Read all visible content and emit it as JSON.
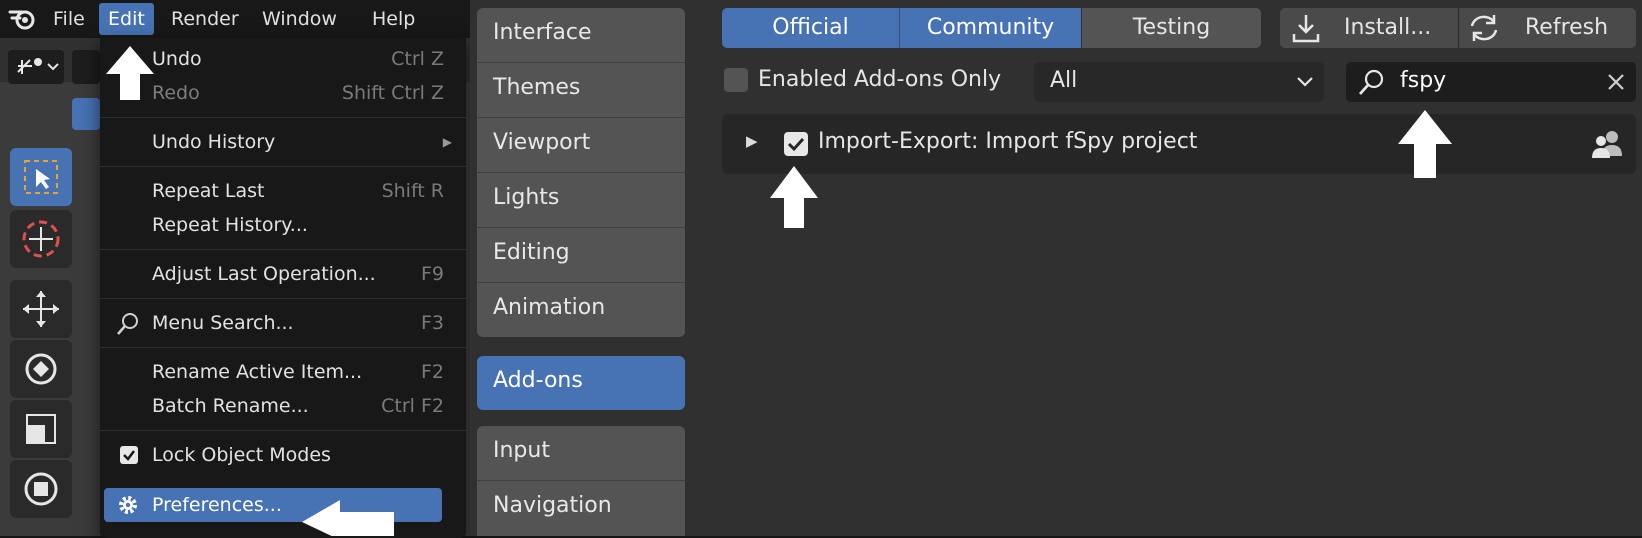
{
  "menubar": {
    "items": [
      "File",
      "Edit",
      "Render",
      "Window",
      "Help"
    ],
    "active": "Edit"
  },
  "edit_menu": {
    "items": [
      {
        "label": "Undo",
        "shortcut": "Ctrl Z"
      },
      {
        "label": "Redo",
        "shortcut": "Shift Ctrl Z",
        "disabled": true
      },
      {
        "label": "Undo History",
        "submenu": true
      },
      {
        "label": "Repeat Last",
        "shortcut": "Shift R"
      },
      {
        "label": "Repeat History..."
      },
      {
        "label": "Adjust Last Operation...",
        "shortcut": "F9"
      },
      {
        "label": "Menu Search...",
        "shortcut": "F3"
      },
      {
        "label": "Rename Active Item...",
        "shortcut": "F2"
      },
      {
        "label": "Batch Rename...",
        "shortcut": "Ctrl F2"
      },
      {
        "label": "Lock Object Modes",
        "checked": true
      },
      {
        "label": "Preferences...",
        "highlighted": true
      }
    ]
  },
  "prefs_nav": {
    "group1": [
      "Interface",
      "Themes",
      "Viewport",
      "Lights",
      "Editing",
      "Animation"
    ],
    "group2": [
      "Add-ons"
    ],
    "group3": [
      "Input",
      "Navigation"
    ],
    "active": "Add-ons"
  },
  "addons": {
    "tabs": [
      "Official",
      "Community",
      "Testing"
    ],
    "install_label": "Install...",
    "refresh_label": "Refresh",
    "enabled_only_label": "Enabled Add-ons Only",
    "category_value": "All",
    "search_value": "fspy",
    "result_label": "Import-Export: Import fSpy project"
  },
  "colors": {
    "accent": "#4772b3",
    "menu_bg": "#181818",
    "panel_bg": "#303030",
    "nav_item": "#545454"
  }
}
